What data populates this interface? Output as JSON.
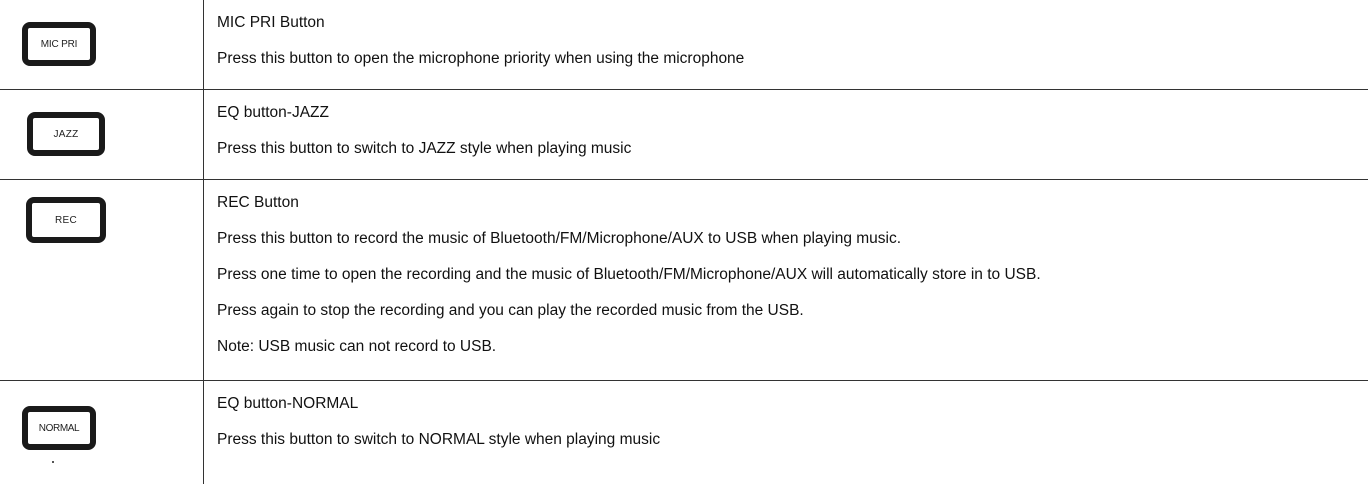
{
  "rows": [
    {
      "button_label": "MIC PRI",
      "title": "MIC PRI Button",
      "lines": [
        "Press this button to open the microphone priority when using the microphone"
      ]
    },
    {
      "button_label": "JAZZ",
      "title": "EQ button-JAZZ",
      "lines": [
        "Press this button to switch to JAZZ style when playing music"
      ]
    },
    {
      "button_label": "REC",
      "title": "REC Button",
      "lines": [
        "Press this button to record the music of Bluetooth/FM/Microphone/AUX to USB when playing music.",
        "Press one time to open the recording and the music of Bluetooth/FM/Microphone/AUX will automatically store in to USB.",
        "Press again to stop the recording and you can play the recorded music from the USB.",
        "Note: USB music can not record to USB."
      ]
    },
    {
      "button_label": "NORMAL",
      "title": "EQ button-NORMAL",
      "lines": [
        "Press this button to switch to NORMAL style when playing music"
      ]
    }
  ]
}
